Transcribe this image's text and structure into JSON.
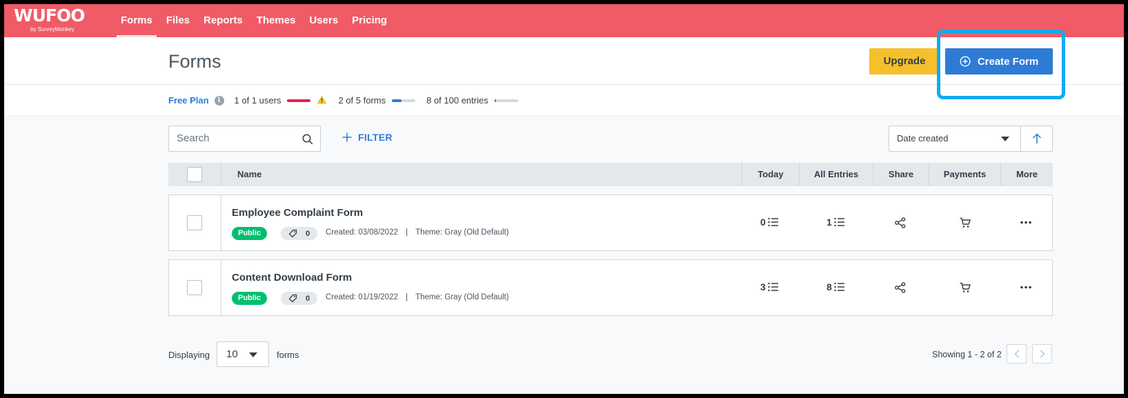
{
  "app": {
    "logo_text": "WUFOO",
    "logo_sub": "by SurveyMonkey"
  },
  "nav": {
    "items": [
      {
        "label": "Forms",
        "active": true
      },
      {
        "label": "Files",
        "active": false
      },
      {
        "label": "Reports",
        "active": false
      },
      {
        "label": "Themes",
        "active": false
      },
      {
        "label": "Users",
        "active": false
      },
      {
        "label": "Pricing",
        "active": false
      }
    ]
  },
  "header": {
    "title": "Forms",
    "upgrade_label": "Upgrade",
    "create_label": "Create Form"
  },
  "plan": {
    "name": "Free Plan",
    "info_icon": "i",
    "users_text": "1 of 1 users",
    "users_fraction": 1.0,
    "users_color": "#e4234f",
    "forms_text": "2 of 5 forms",
    "forms_fraction": 0.4,
    "forms_color": "#2e7bd6",
    "entries_text": "8 of 100 entries",
    "entries_fraction": 0.08,
    "entries_color": "#2e7bd6"
  },
  "toolbar": {
    "search_placeholder": "Search",
    "filter_label": "FILTER",
    "sort_value": "Date created"
  },
  "table": {
    "columns": {
      "name": "Name",
      "today": "Today",
      "all_entries": "All Entries",
      "share": "Share",
      "payments": "Payments",
      "more": "More"
    },
    "rows": [
      {
        "name": "Employee Complaint Form",
        "status": "Public",
        "tags": "0",
        "created": "Created: 03/08/2022",
        "separator": "|",
        "theme": "Theme: Gray (Old Default)",
        "today": "0",
        "all_entries": "1"
      },
      {
        "name": "Content Download Form",
        "status": "Public",
        "tags": "0",
        "created": "Created: 01/19/2022",
        "separator": "|",
        "theme": "Theme: Gray (Old Default)",
        "today": "3",
        "all_entries": "8"
      }
    ]
  },
  "footer": {
    "displaying_label": "Displaying",
    "per_page": "10",
    "forms_label": "forms",
    "showing_text": "Showing 1 - 2 of 2"
  },
  "colors": {
    "nav_bg": "#f05b67",
    "primary": "#2e7bd6",
    "upgrade": "#f6c02d",
    "public_badge": "#00bf6f",
    "highlight": "#11aaef"
  }
}
